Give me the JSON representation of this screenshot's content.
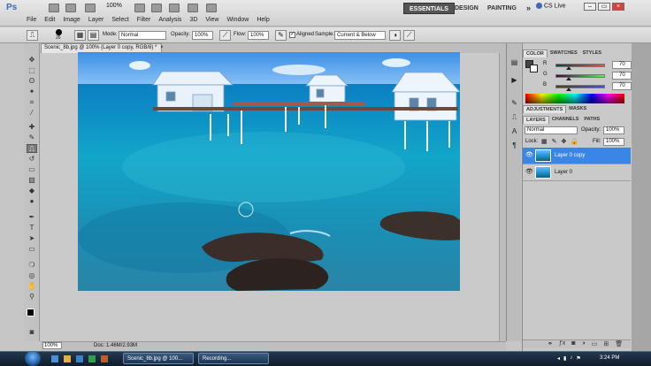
{
  "app": {
    "logo": "Ps",
    "zoom": "100%",
    "menus": [
      "File",
      "Edit",
      "Image",
      "Layer",
      "Select",
      "Filter",
      "Analysis",
      "3D",
      "View",
      "Window",
      "Help"
    ],
    "workspaces": {
      "essentials": "ESSENTIALS",
      "design": "DESIGN",
      "painting": "PAINTING",
      "more": "»"
    },
    "cslive": "CS Live",
    "window_buttons": {
      "minimize": "–",
      "restore": "▭",
      "close": "×"
    }
  },
  "options": {
    "brush_size": "26",
    "mode_label": "Mode:",
    "mode_value": "Normal",
    "opacity_label": "Opacity:",
    "opacity_value": "100%",
    "flow_label": "Flow:",
    "flow_value": "100%",
    "aligned_label": "Aligned",
    "sample_label": "Sample:",
    "sample_value": "Current & Below"
  },
  "document": {
    "tab_title": "Scenic_8b.jpg @ 100% (Layer 0 copy, RGB/8) *",
    "zoom": "100%",
    "docsize": "Doc: 1.46M/2.93M"
  },
  "color_panel": {
    "tabs": [
      "COLOR",
      "SWATCHES",
      "STYLES"
    ],
    "channels": [
      {
        "label": "R",
        "value": "70",
        "level": 0.27
      },
      {
        "label": "G",
        "value": "70",
        "level": 0.27
      },
      {
        "label": "B",
        "value": "70",
        "level": 0.27
      }
    ]
  },
  "adjust_tabs": [
    "ADJUSTMENTS",
    "MASKS"
  ],
  "layers_panel": {
    "tabs": [
      "LAYERS",
      "CHANNELS",
      "PATHS"
    ],
    "blend": "Normal",
    "opacity_label": "Opacity:",
    "opacity_value": "100%",
    "lock_label": "Lock:",
    "fill_label": "Fill:",
    "fill_value": "100%",
    "layers": [
      {
        "name": "Layer 0 copy",
        "selected": true
      },
      {
        "name": "Layer 0",
        "selected": false
      }
    ]
  },
  "taskbar": {
    "tasks": [
      "Scenic_8b.jpg @ 100...",
      "Recording..."
    ],
    "clock": "3:24 PM"
  },
  "colors": {
    "accent": "#3a86e6",
    "water": "#1a93c8"
  }
}
